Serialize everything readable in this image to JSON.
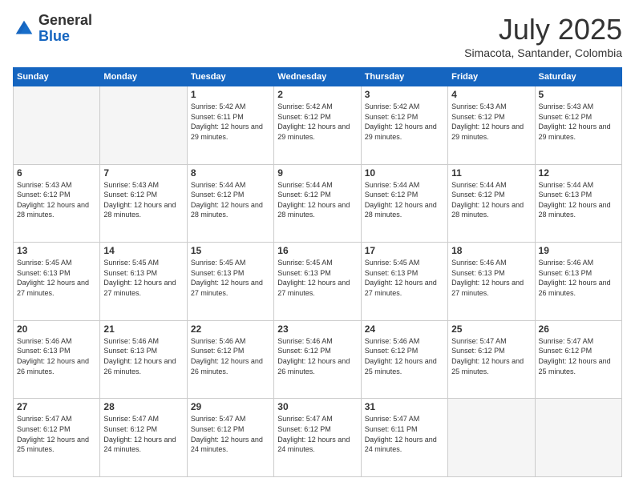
{
  "header": {
    "logo_general": "General",
    "logo_blue": "Blue",
    "month_title": "July 2025",
    "subtitle": "Simacota, Santander, Colombia"
  },
  "weekdays": [
    "Sunday",
    "Monday",
    "Tuesday",
    "Wednesday",
    "Thursday",
    "Friday",
    "Saturday"
  ],
  "weeks": [
    [
      {
        "day": "",
        "info": ""
      },
      {
        "day": "",
        "info": ""
      },
      {
        "day": "1",
        "info": "Sunrise: 5:42 AM\nSunset: 6:11 PM\nDaylight: 12 hours and 29 minutes."
      },
      {
        "day": "2",
        "info": "Sunrise: 5:42 AM\nSunset: 6:12 PM\nDaylight: 12 hours and 29 minutes."
      },
      {
        "day": "3",
        "info": "Sunrise: 5:42 AM\nSunset: 6:12 PM\nDaylight: 12 hours and 29 minutes."
      },
      {
        "day": "4",
        "info": "Sunrise: 5:43 AM\nSunset: 6:12 PM\nDaylight: 12 hours and 29 minutes."
      },
      {
        "day": "5",
        "info": "Sunrise: 5:43 AM\nSunset: 6:12 PM\nDaylight: 12 hours and 29 minutes."
      }
    ],
    [
      {
        "day": "6",
        "info": "Sunrise: 5:43 AM\nSunset: 6:12 PM\nDaylight: 12 hours and 28 minutes."
      },
      {
        "day": "7",
        "info": "Sunrise: 5:43 AM\nSunset: 6:12 PM\nDaylight: 12 hours and 28 minutes."
      },
      {
        "day": "8",
        "info": "Sunrise: 5:44 AM\nSunset: 6:12 PM\nDaylight: 12 hours and 28 minutes."
      },
      {
        "day": "9",
        "info": "Sunrise: 5:44 AM\nSunset: 6:12 PM\nDaylight: 12 hours and 28 minutes."
      },
      {
        "day": "10",
        "info": "Sunrise: 5:44 AM\nSunset: 6:12 PM\nDaylight: 12 hours and 28 minutes."
      },
      {
        "day": "11",
        "info": "Sunrise: 5:44 AM\nSunset: 6:12 PM\nDaylight: 12 hours and 28 minutes."
      },
      {
        "day": "12",
        "info": "Sunrise: 5:44 AM\nSunset: 6:13 PM\nDaylight: 12 hours and 28 minutes."
      }
    ],
    [
      {
        "day": "13",
        "info": "Sunrise: 5:45 AM\nSunset: 6:13 PM\nDaylight: 12 hours and 27 minutes."
      },
      {
        "day": "14",
        "info": "Sunrise: 5:45 AM\nSunset: 6:13 PM\nDaylight: 12 hours and 27 minutes."
      },
      {
        "day": "15",
        "info": "Sunrise: 5:45 AM\nSunset: 6:13 PM\nDaylight: 12 hours and 27 minutes."
      },
      {
        "day": "16",
        "info": "Sunrise: 5:45 AM\nSunset: 6:13 PM\nDaylight: 12 hours and 27 minutes."
      },
      {
        "day": "17",
        "info": "Sunrise: 5:45 AM\nSunset: 6:13 PM\nDaylight: 12 hours and 27 minutes."
      },
      {
        "day": "18",
        "info": "Sunrise: 5:46 AM\nSunset: 6:13 PM\nDaylight: 12 hours and 27 minutes."
      },
      {
        "day": "19",
        "info": "Sunrise: 5:46 AM\nSunset: 6:13 PM\nDaylight: 12 hours and 26 minutes."
      }
    ],
    [
      {
        "day": "20",
        "info": "Sunrise: 5:46 AM\nSunset: 6:13 PM\nDaylight: 12 hours and 26 minutes."
      },
      {
        "day": "21",
        "info": "Sunrise: 5:46 AM\nSunset: 6:13 PM\nDaylight: 12 hours and 26 minutes."
      },
      {
        "day": "22",
        "info": "Sunrise: 5:46 AM\nSunset: 6:12 PM\nDaylight: 12 hours and 26 minutes."
      },
      {
        "day": "23",
        "info": "Sunrise: 5:46 AM\nSunset: 6:12 PM\nDaylight: 12 hours and 26 minutes."
      },
      {
        "day": "24",
        "info": "Sunrise: 5:46 AM\nSunset: 6:12 PM\nDaylight: 12 hours and 25 minutes."
      },
      {
        "day": "25",
        "info": "Sunrise: 5:47 AM\nSunset: 6:12 PM\nDaylight: 12 hours and 25 minutes."
      },
      {
        "day": "26",
        "info": "Sunrise: 5:47 AM\nSunset: 6:12 PM\nDaylight: 12 hours and 25 minutes."
      }
    ],
    [
      {
        "day": "27",
        "info": "Sunrise: 5:47 AM\nSunset: 6:12 PM\nDaylight: 12 hours and 25 minutes."
      },
      {
        "day": "28",
        "info": "Sunrise: 5:47 AM\nSunset: 6:12 PM\nDaylight: 12 hours and 24 minutes."
      },
      {
        "day": "29",
        "info": "Sunrise: 5:47 AM\nSunset: 6:12 PM\nDaylight: 12 hours and 24 minutes."
      },
      {
        "day": "30",
        "info": "Sunrise: 5:47 AM\nSunset: 6:12 PM\nDaylight: 12 hours and 24 minutes."
      },
      {
        "day": "31",
        "info": "Sunrise: 5:47 AM\nSunset: 6:11 PM\nDaylight: 12 hours and 24 minutes."
      },
      {
        "day": "",
        "info": ""
      },
      {
        "day": "",
        "info": ""
      }
    ]
  ]
}
